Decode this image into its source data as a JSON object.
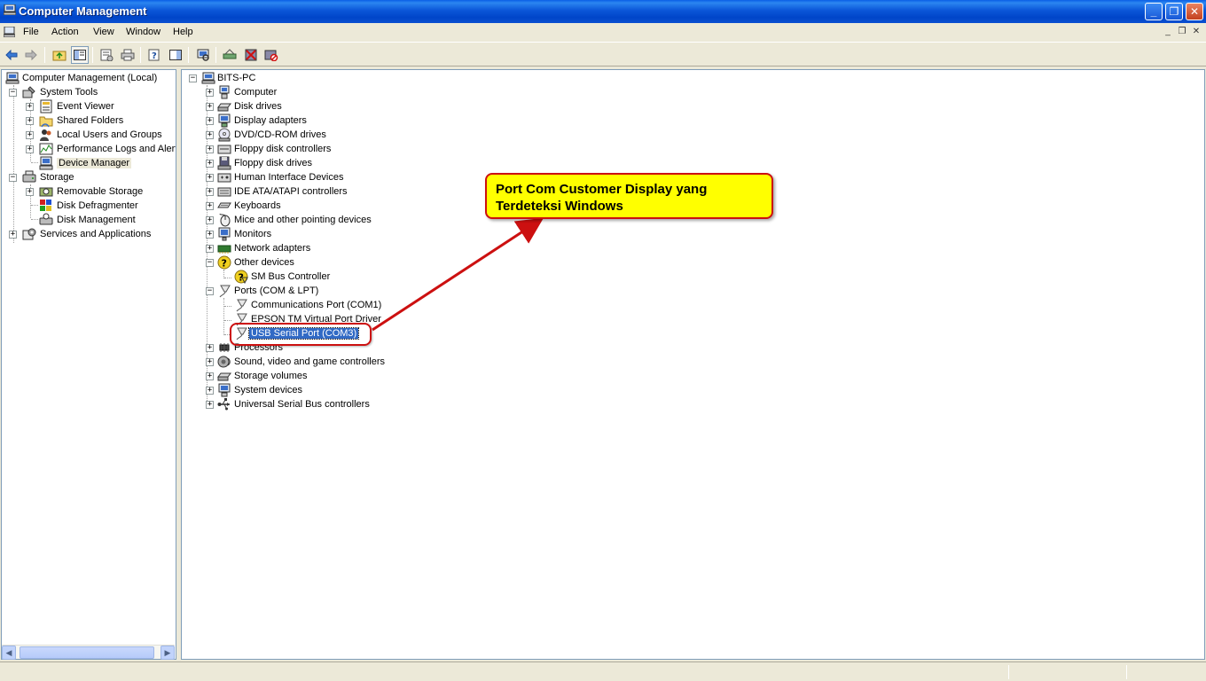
{
  "window": {
    "title": "Computer Management"
  },
  "menu": [
    "File",
    "Action",
    "View",
    "Window",
    "Help"
  ],
  "left_tree": {
    "root": "Computer Management (Local)",
    "items": [
      {
        "label": "System Tools",
        "icon": "tools-icon"
      },
      {
        "label": "Event Viewer",
        "icon": "event-viewer-icon"
      },
      {
        "label": "Shared Folders",
        "icon": "shared-folder-icon"
      },
      {
        "label": "Local Users and Groups",
        "icon": "users-icon"
      },
      {
        "label": "Performance Logs and Alerts",
        "icon": "performance-icon"
      },
      {
        "label": "Device Manager",
        "icon": "device-manager-icon"
      },
      {
        "label": "Storage",
        "icon": "storage-icon"
      },
      {
        "label": "Removable Storage",
        "icon": "removable-storage-icon"
      },
      {
        "label": "Disk Defragmenter",
        "icon": "defrag-icon"
      },
      {
        "label": "Disk Management",
        "icon": "disk-management-icon"
      },
      {
        "label": "Services and Applications",
        "icon": "services-icon"
      }
    ]
  },
  "device_tree": {
    "root": "BITS-PC",
    "items": [
      {
        "label": "Computer",
        "icon": "computer-icon"
      },
      {
        "label": "Disk drives",
        "icon": "disk-drive-icon"
      },
      {
        "label": "Display adapters",
        "icon": "display-adapter-icon"
      },
      {
        "label": "DVD/CD-ROM drives",
        "icon": "cdrom-icon"
      },
      {
        "label": "Floppy disk controllers",
        "icon": "floppy-controller-icon"
      },
      {
        "label": "Floppy disk drives",
        "icon": "floppy-drive-icon"
      },
      {
        "label": "Human Interface Devices",
        "icon": "hid-icon"
      },
      {
        "label": "IDE ATA/ATAPI controllers",
        "icon": "ide-controller-icon"
      },
      {
        "label": "Keyboards",
        "icon": "keyboard-icon"
      },
      {
        "label": "Mice and other pointing devices",
        "icon": "mouse-icon"
      },
      {
        "label": "Monitors",
        "icon": "monitor-icon"
      },
      {
        "label": "Network adapters",
        "icon": "network-adapter-icon"
      },
      {
        "label": "Other devices",
        "icon": "unknown-device-icon"
      },
      {
        "label": "SM Bus Controller",
        "icon": "warning-device-icon"
      },
      {
        "label": "Ports (COM & LPT)",
        "icon": "port-icon"
      },
      {
        "label": "Communications Port (COM1)",
        "icon": "port-icon"
      },
      {
        "label": "EPSON TM Virtual Port Driver",
        "icon": "port-icon"
      },
      {
        "label": "USB Serial Port (COM3)",
        "icon": "port-icon"
      },
      {
        "label": "Processors",
        "icon": "processor-icon"
      },
      {
        "label": "Sound, video and game controllers",
        "icon": "sound-icon"
      },
      {
        "label": "Storage volumes",
        "icon": "storage-volume-icon"
      },
      {
        "label": "System devices",
        "icon": "system-device-icon"
      },
      {
        "label": "Universal Serial Bus controllers",
        "icon": "usb-icon"
      }
    ]
  },
  "annotation": {
    "line1": "Port Com Customer Display yang",
    "line2": "Terdeteksi Windows"
  },
  "colors": {
    "callout_fill": "#ffff00",
    "callout_border": "#cc1010",
    "selection": "#316ac5",
    "titlebar": "#0a4fd0"
  }
}
